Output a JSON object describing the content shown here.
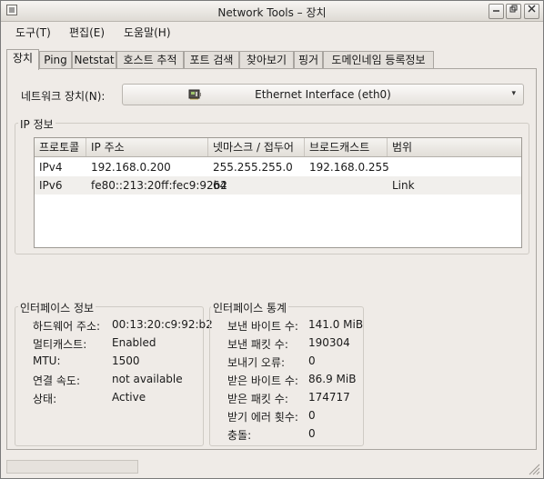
{
  "window": {
    "title": "Network Tools – 장치",
    "controls": [
      "minimize",
      "restore",
      "close"
    ]
  },
  "menu": [
    {
      "label": "도구(T)"
    },
    {
      "label": "편집(E)"
    },
    {
      "label": "도움말(H)"
    }
  ],
  "tabs": [
    {
      "label": "장치",
      "active": true
    },
    {
      "label": "Ping"
    },
    {
      "label": "Netstat"
    },
    {
      "label": "호스트 추적"
    },
    {
      "label": "포트 검색"
    },
    {
      "label": "찾아보기"
    },
    {
      "label": "핑거"
    },
    {
      "label": "도메인네임 등록정보"
    }
  ],
  "device": {
    "label": "네트워크 장치(N):",
    "selected": "Ethernet Interface (eth0)",
    "icon": "network-card-icon"
  },
  "ip_info": {
    "title": "IP 정보",
    "columns": [
      "프로토콜",
      "IP 주소",
      "넷마스크 / 접두어",
      "브로드캐스트",
      "범위"
    ],
    "rows": [
      {
        "protocol": "IPv4",
        "address": "192.168.0.200",
        "netmask": "255.255.255.0",
        "broadcast": "192.168.0.255",
        "scope": ""
      },
      {
        "protocol": "IPv6",
        "address": "fe80::213:20ff:fec9:92b2",
        "netmask": "64",
        "broadcast": "",
        "scope": "Link"
      }
    ]
  },
  "interface_info": {
    "title": "인터페이스 정보",
    "rows": [
      {
        "label": "하드웨어 주소:",
        "value": "00:13:20:c9:92:b2"
      },
      {
        "label": "멀티캐스트:",
        "value": "Enabled"
      },
      {
        "label": "MTU:",
        "value": "1500"
      },
      {
        "label": "연결 속도:",
        "value": "not available"
      },
      {
        "label": "상태:",
        "value": "Active"
      }
    ]
  },
  "interface_stats": {
    "title": "인터페이스 통계",
    "rows": [
      {
        "label": "보낸 바이트 수:",
        "value": "141.0 MiB"
      },
      {
        "label": "보낸 패킷 수:",
        "value": "190304"
      },
      {
        "label": "보내기 오류:",
        "value": "0"
      },
      {
        "label": "받은 바이트 수:",
        "value": "86.9 MiB"
      },
      {
        "label": "받은 패킷 수:",
        "value": "174717"
      },
      {
        "label": "받기 에러 횟수:",
        "value": "0"
      },
      {
        "label": "충돌:",
        "value": "0"
      }
    ]
  }
}
